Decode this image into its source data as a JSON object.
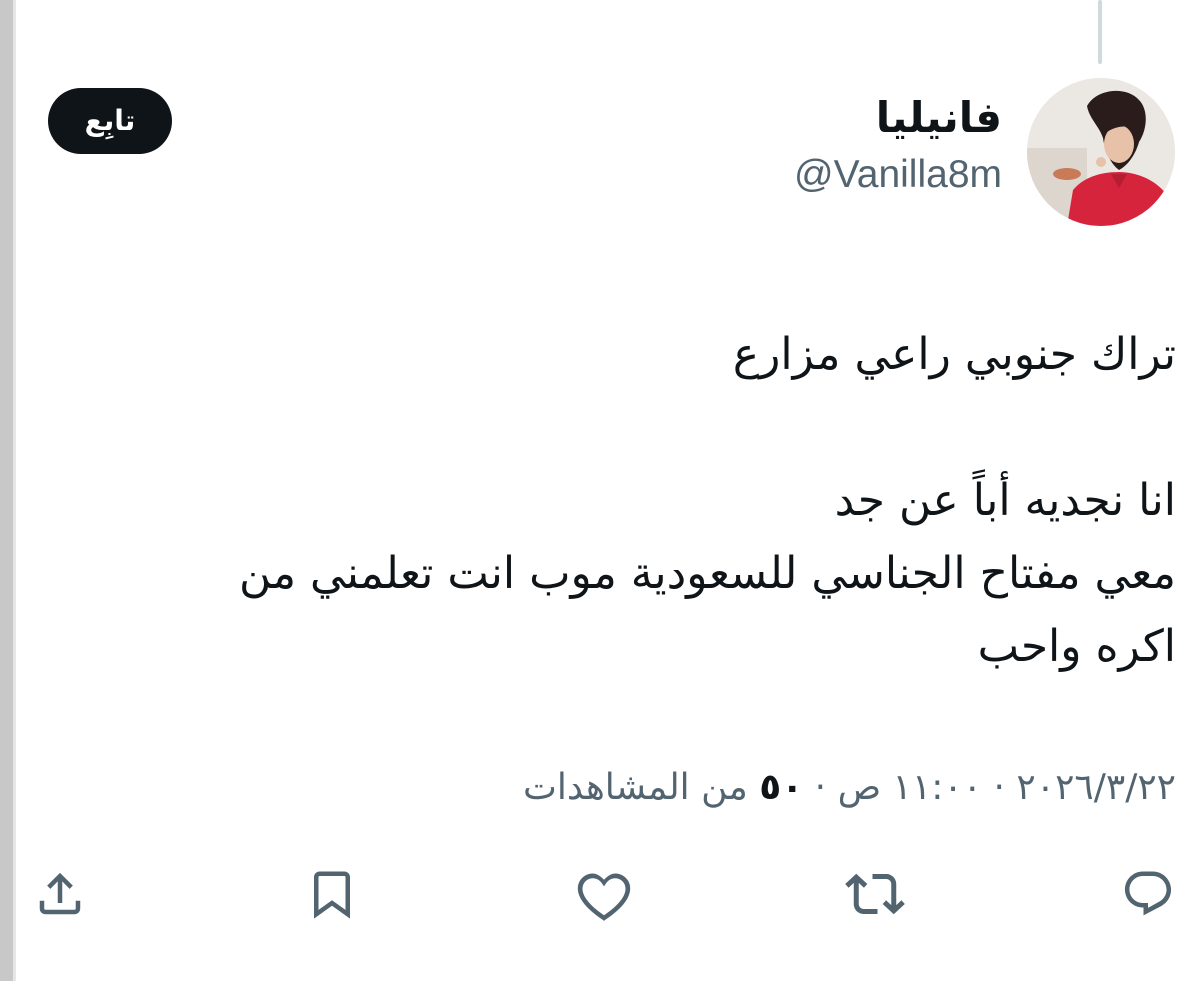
{
  "account": {
    "display_name": "فانيليا",
    "handle": "@Vanilla8m"
  },
  "follow_button": {
    "label": "تابِع"
  },
  "tweet": {
    "lines": [
      "تراك جنوبي راعي مزارع",
      "",
      "انا نجديه أباً عن جد",
      "معي مفتاح الجناسي للسعودية موب انت تعلمني من",
      "اكره واحب"
    ]
  },
  "meta": {
    "date": "٢٠٢٦/٣/٢٢",
    "separator": "·",
    "time": "١١:٠٠ ص",
    "views_count": "٥٠",
    "views_label": "من المشاهدات"
  },
  "actions": {
    "icons": [
      "reply-icon",
      "retweet-icon",
      "like-icon",
      "bookmark-icon",
      "share-icon"
    ]
  },
  "colors": {
    "text_primary": "#0f1419",
    "text_secondary": "#536471",
    "icon": "#536471",
    "button_bg": "#0f1419",
    "button_text": "#ffffff",
    "border": "#cfd9de"
  }
}
